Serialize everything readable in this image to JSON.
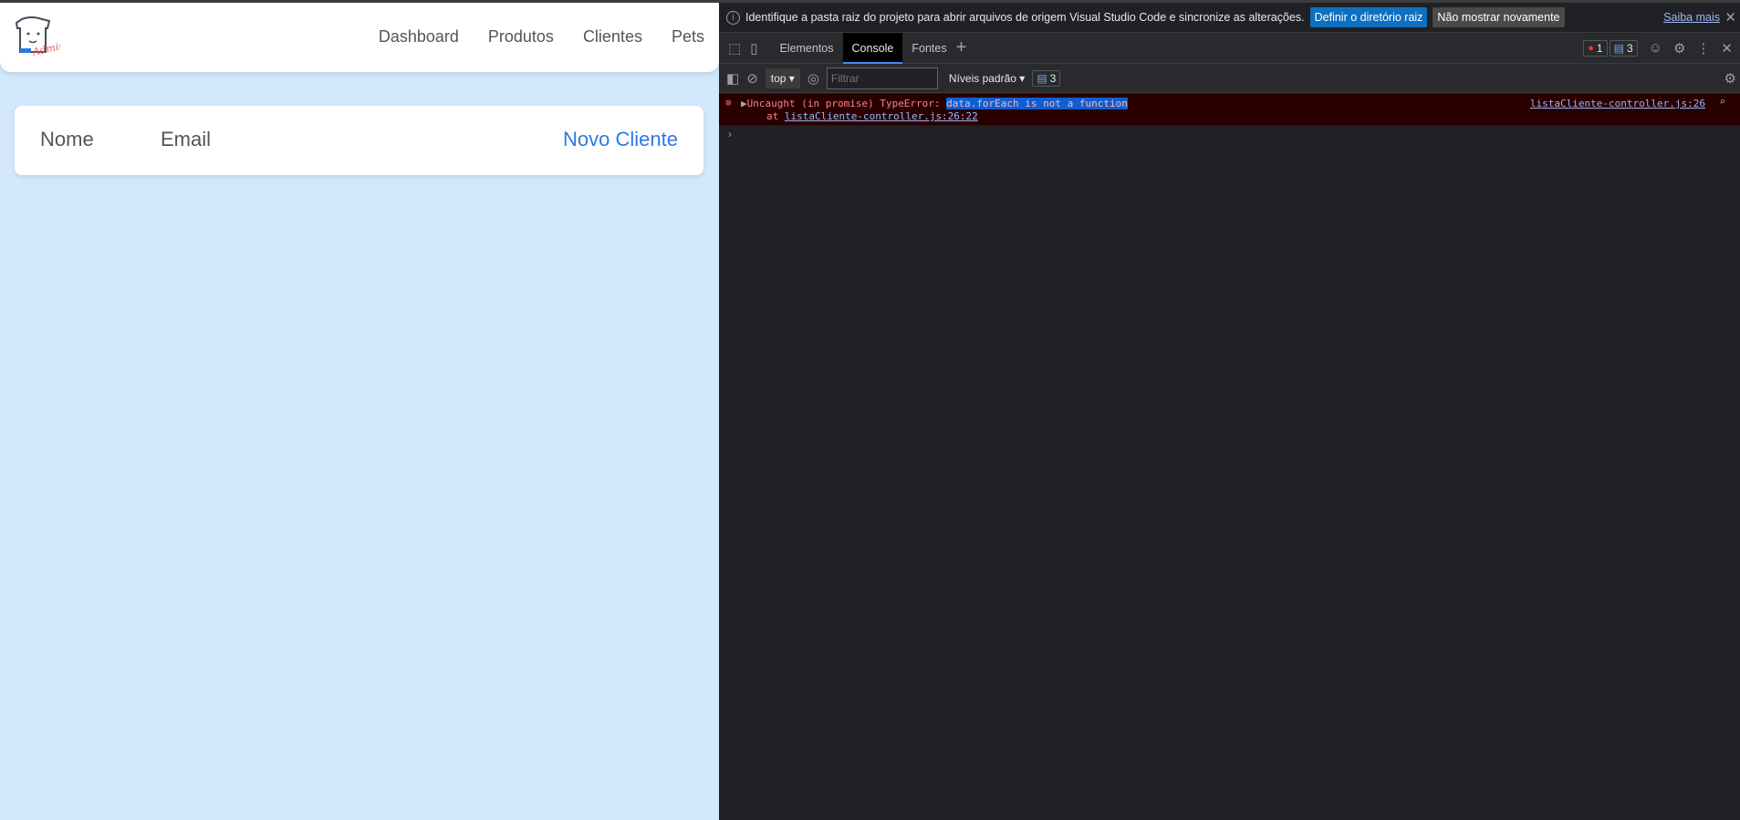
{
  "page": {
    "logo_text": "Admin",
    "nav": [
      "Dashboard",
      "Produtos",
      "Clientes",
      "Pets"
    ],
    "table": {
      "headers": [
        "Nome",
        "Email"
      ],
      "new_button": "Novo Cliente"
    }
  },
  "devtools": {
    "infobar": {
      "message": "Identifique a pasta raiz do projeto para abrir arquivos de origem Visual Studio Code e sincronize as alterações.",
      "primary_button": "Definir o diretório raiz",
      "secondary_button": "Não mostrar novamente",
      "link": "Saiba mais"
    },
    "tabs": [
      "Elementos",
      "Console",
      "Fontes"
    ],
    "active_tab": "Console",
    "error_count": "1",
    "message_count": "3",
    "toolbar": {
      "context": "top",
      "filter_placeholder": "Filtrar",
      "levels": "Níveis padrão",
      "messages": "3"
    },
    "error": {
      "prefix": "Uncaught (in promise) TypeError: ",
      "message": "data.forEach is not a function",
      "at": "at ",
      "location": "listaCliente-controller.js:26:22",
      "source": "listaCliente-controller.js:26"
    },
    "colors": {
      "accent": "#3d8df5",
      "error_bg": "#290000",
      "primary_btn": "#0e70c0"
    }
  }
}
